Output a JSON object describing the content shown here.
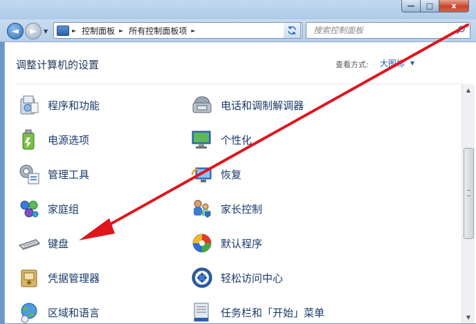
{
  "window": {
    "min_glyph": "—",
    "max_glyph": "□",
    "close_glyph": "x"
  },
  "navigation": {
    "back_glyph": "◄",
    "forward_glyph": "►",
    "breadcrumbs": [
      "控制面板",
      "所有控制面板项"
    ],
    "search_placeholder": "搜索控制面板"
  },
  "content": {
    "title": "调整计算机的设置",
    "view_by_label": "查看方式:",
    "view_by_value": "大图标"
  },
  "items_left": [
    {
      "label": "程序和功能",
      "icon": "programs-features-icon"
    },
    {
      "label": "电源选项",
      "icon": "power-options-icon"
    },
    {
      "label": "管理工具",
      "icon": "admin-tools-icon"
    },
    {
      "label": "家庭组",
      "icon": "homegroup-icon"
    },
    {
      "label": "键盘",
      "icon": "keyboard-icon"
    },
    {
      "label": "凭据管理器",
      "icon": "credential-manager-icon"
    },
    {
      "label": "区域和语言",
      "icon": "region-language-icon"
    }
  ],
  "items_right": [
    {
      "label": "电话和调制解调器",
      "icon": "phone-modem-icon"
    },
    {
      "label": "个性化",
      "icon": "personalization-icon"
    },
    {
      "label": "恢复",
      "icon": "recovery-icon"
    },
    {
      "label": "家长控制",
      "icon": "parental-controls-icon"
    },
    {
      "label": "默认程序",
      "icon": "default-programs-icon"
    },
    {
      "label": "轻松访问中心",
      "icon": "ease-of-access-icon"
    },
    {
      "label": "任务栏和「开始」菜单",
      "icon": "taskbar-start-menu-icon"
    }
  ],
  "colors": {
    "link": "#1a3a6b",
    "title": "#1e395b",
    "annotation_arrow": "#e0141c"
  }
}
